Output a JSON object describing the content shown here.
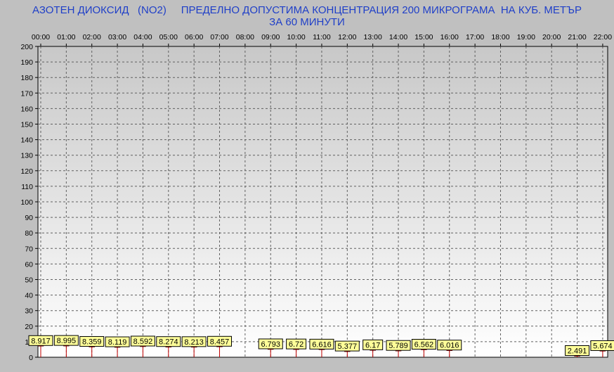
{
  "title": {
    "line1": "АЗОТЕН ДИОКСИД   (NO2)     ПРЕДЕЛНО ДОПУСТИМА КОНЦЕНТРАЦИЯ 200 МИКРОГРАМА  НА КУБ. МЕТЪР",
    "line2": "ЗА 60 МИНУТИ"
  },
  "colors": {
    "background": "#c0c0c0",
    "title": "#1f3fc8",
    "bar": "#c00000",
    "label_fill": "#ffff99",
    "grid": "#606060"
  },
  "chart_data": {
    "type": "bar",
    "categories": [
      "00:00",
      "01:00",
      "02:00",
      "03:00",
      "04:00",
      "05:00",
      "06:00",
      "07:00",
      "08:00",
      "09:00",
      "10:00",
      "11:00",
      "12:00",
      "13:00",
      "14:00",
      "15:00",
      "16:00",
      "17:00",
      "18:00",
      "19:00",
      "20:00",
      "21:00",
      "22:00"
    ],
    "values": [
      8.917,
      8.995,
      8.359,
      8.119,
      8.592,
      8.274,
      8.213,
      8.457,
      null,
      6.793,
      6.72,
      6.616,
      5.377,
      6.17,
      5.789,
      6.562,
      6.016,
      null,
      null,
      null,
      null,
      2.491,
      5.674
    ],
    "value_labels": [
      "8.917",
      "8.995",
      "8.359",
      "8.119",
      "8.592",
      "8.274",
      "8.213",
      "8.457",
      null,
      "6.793",
      "6.72",
      "6.616",
      "5.377",
      "6.17",
      "5.789",
      "6.562",
      "6.016",
      null,
      null,
      null,
      null,
      "2.491",
      "5.674"
    ],
    "yticks": [
      "0",
      "10",
      "20",
      "30",
      "40",
      "50",
      "60",
      "70",
      "80",
      "90",
      "100",
      "110",
      "120",
      "130",
      "140",
      "150",
      "160",
      "170",
      "180",
      "190",
      "200"
    ],
    "ylim": [
      0,
      200
    ],
    "x_axis_position": "top",
    "grid": true
  }
}
